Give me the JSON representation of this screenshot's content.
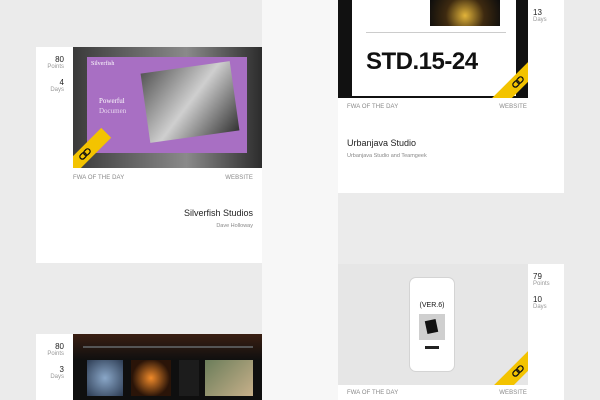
{
  "colors": {
    "accent": "#f3c300",
    "purple": "#a86fc3",
    "dark": "#111111",
    "bg": "#ebebeb"
  },
  "cards": [
    {
      "points": "80",
      "points_label": "Points",
      "days": "4",
      "days_label": "Days",
      "tag_left": "FWA OF THE DAY",
      "tag_right": "WEBSITE",
      "title": "Silverfish Studios",
      "author": "Dave Holloway",
      "thumb": {
        "brand": "Silverfish",
        "headline_1": "Powerful",
        "headline_2": "Documen"
      }
    },
    {
      "points": "",
      "days": "13",
      "days_label": "Days",
      "tag_left": "FWA OF THE DAY",
      "tag_right": "WEBSITE",
      "title": "Urbanjava Studio",
      "author": "Urbanjava Studio and Teamgeek",
      "thumb": {
        "headline": "STD.15-24"
      }
    },
    {
      "points": "80",
      "points_label": "Points",
      "days": "3",
      "days_label": "Days"
    },
    {
      "points": "79",
      "points_label": "Points",
      "days": "10",
      "days_label": "Days",
      "tag_left": "FWA OF THE DAY",
      "tag_right": "WEBSITE",
      "thumb": {
        "label": "(VER.6)"
      }
    }
  ]
}
